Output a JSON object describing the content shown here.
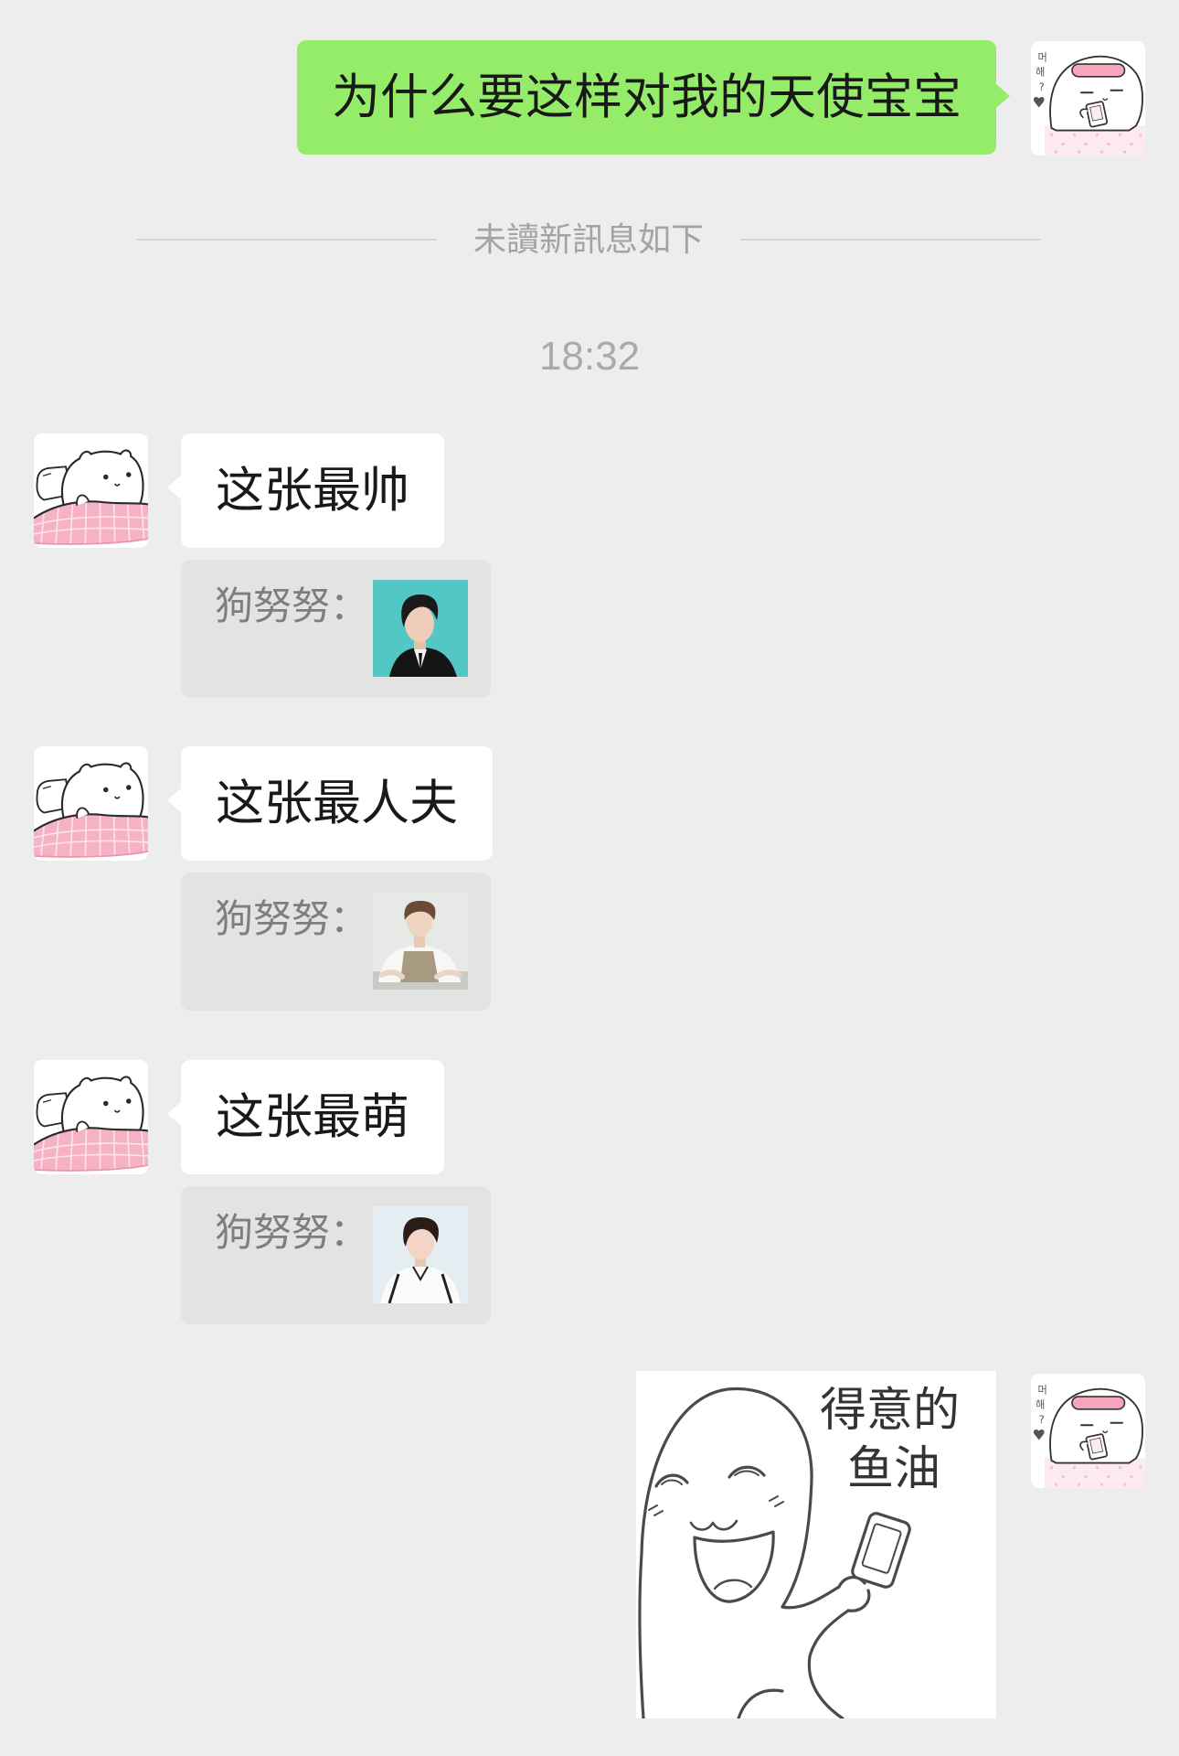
{
  "colors": {
    "chat_background": "#ededed",
    "sent_bubble": "#95ec69",
    "received_bubble": "#ffffff",
    "quote_block": "#e3e3e3",
    "message_text": "#191919",
    "divider_text": "#a3a3a3",
    "timestamp_text": "#aaaaaa",
    "quote_text": "#7e7e7e",
    "divider_line": "#d6d6d6"
  },
  "self": {
    "avatar_lettering": [
      "머",
      "해",
      "?"
    ]
  },
  "outgoing_text": {
    "text": "为什么要这样对我的天使宝宝"
  },
  "unread_divider": {
    "label": "未讀新訊息如下"
  },
  "timestamp": {
    "label": "18:32"
  },
  "incoming": [
    {
      "text": "这张最帅",
      "quote": {
        "sender": "狗努努："
      }
    },
    {
      "text": "这张最人夫",
      "quote": {
        "sender": "狗努努："
      }
    },
    {
      "text": "这张最萌",
      "quote": {
        "sender": "狗努努："
      }
    }
  ],
  "outgoing_sticker": {
    "caption": [
      "得意的",
      "鱼油"
    ]
  }
}
